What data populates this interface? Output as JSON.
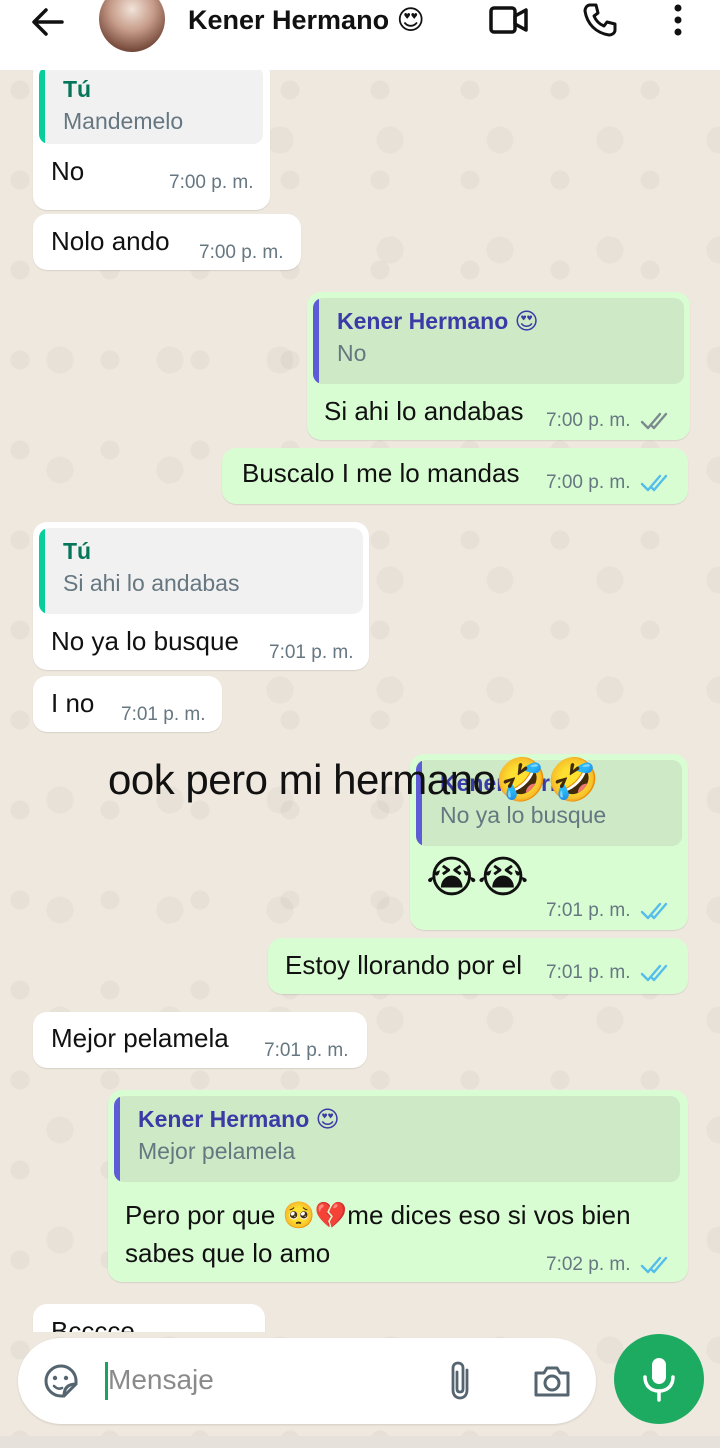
{
  "header": {
    "contact_name": "Kener Hermano 😍"
  },
  "overlay_text": "ook pero mi hermano🤣🤣",
  "messages": [
    {
      "dir": "in",
      "quote": {
        "name": "Tú",
        "text": "Mandemelo"
      },
      "text": "No",
      "time": "7:00 p. m."
    },
    {
      "dir": "in",
      "text": "Nolo ando",
      "time": "7:00 p. m."
    },
    {
      "dir": "out",
      "quote": {
        "name": "Kener Hermano 😍",
        "text": "No"
      },
      "text": "Si ahi lo andabas",
      "time": "7:00 p. m.",
      "status": "delivered"
    },
    {
      "dir": "out",
      "text": "Buscalo I me lo mandas",
      "time": "7:00 p. m.",
      "status": "read"
    },
    {
      "dir": "in",
      "quote": {
        "name": "Tú",
        "text": "Si ahi lo andabas"
      },
      "text": "No ya lo busque",
      "time": "7:01 p. m."
    },
    {
      "dir": "in",
      "text": "I no",
      "time": "7:01 p. m."
    },
    {
      "dir": "out",
      "quote": {
        "name": "Kener Herm",
        "text": "No ya lo busque"
      },
      "text": "😭😭",
      "time": "7:01 p. m.",
      "status": "read"
    },
    {
      "dir": "out",
      "text": "Estoy llorando por el",
      "time": "7:01 p. m.",
      "status": "read"
    },
    {
      "dir": "in",
      "text": "Mejor pelamela",
      "time": "7:01 p. m."
    },
    {
      "dir": "out",
      "quote": {
        "name": "Kener Hermano 😍",
        "text": "Mejor pelamela"
      },
      "text_line1": "Pero por que 🥺💔me dices eso si vos bien",
      "text_line2": "sabes que lo amo",
      "time": "7:02 p. m.",
      "status": "read"
    },
    {
      "dir": "in",
      "text": "Bcccce"
    }
  ],
  "input": {
    "placeholder": "Mensaje"
  },
  "colors": {
    "outgoing_bubble": "#d9fdd3",
    "incoming_bubble": "#ffffff",
    "quote_bar_you": "#06cf9c",
    "quote_bar_contact": "#5e5bd6",
    "read_ticks": "#53bdeb",
    "accent_green": "#1daa61"
  }
}
